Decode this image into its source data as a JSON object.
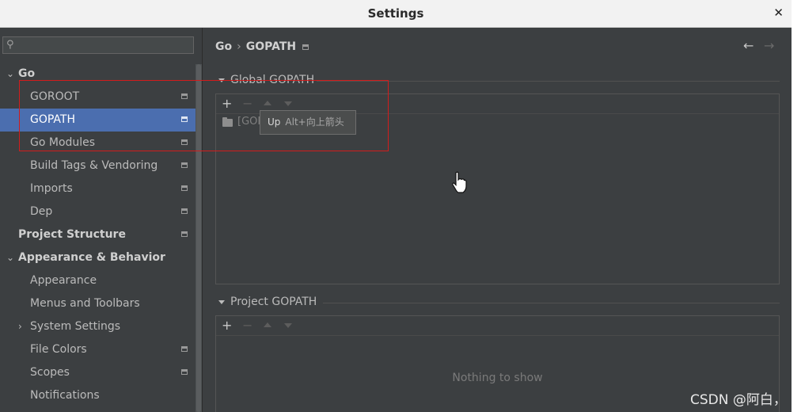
{
  "window": {
    "title": "Settings",
    "close_glyph": "✕"
  },
  "search": {
    "value": "",
    "placeholder": ""
  },
  "sidebar": {
    "items": [
      {
        "label": "Go",
        "level": 0,
        "expanded": true
      },
      {
        "label": "GOROOT",
        "level": 1
      },
      {
        "label": "GOPATH",
        "level": 1,
        "selected": true
      },
      {
        "label": "Go Modules",
        "level": 1
      },
      {
        "label": "Build Tags & Vendoring",
        "level": 1
      },
      {
        "label": "Imports",
        "level": 1
      },
      {
        "label": "Dep",
        "level": 1
      },
      {
        "label": "Project Structure",
        "level": 0
      },
      {
        "label": "Appearance & Behavior",
        "level": 0,
        "expanded": true
      },
      {
        "label": "Appearance",
        "level": 1
      },
      {
        "label": "Menus and Toolbars",
        "level": 1
      },
      {
        "label": "System Settings",
        "level": 1,
        "collapsed": true
      },
      {
        "label": "File Colors",
        "level": 1
      },
      {
        "label": "Scopes",
        "level": 1
      },
      {
        "label": "Notifications",
        "level": 1
      }
    ]
  },
  "breadcrumb": {
    "root": "Go",
    "separator": "›",
    "current": "GOPATH"
  },
  "global_gopath": {
    "header": "Global GOPATH",
    "toolbar": {
      "add": "+",
      "remove": "−"
    },
    "entry": "[GOP"
  },
  "tooltip": {
    "label": "Up",
    "shortcut": "Alt+向上箭头"
  },
  "project_gopath": {
    "header": "Project GOPATH",
    "toolbar": {
      "add": "+",
      "remove": "−"
    },
    "empty_text": "Nothing to show"
  },
  "nav": {
    "back": "←",
    "forward": "→"
  },
  "watermark": "CSDN @阿白，",
  "colors": {
    "selection": "#4b6eaf",
    "background": "#3c3f41",
    "annotation": "#d31c1c"
  }
}
